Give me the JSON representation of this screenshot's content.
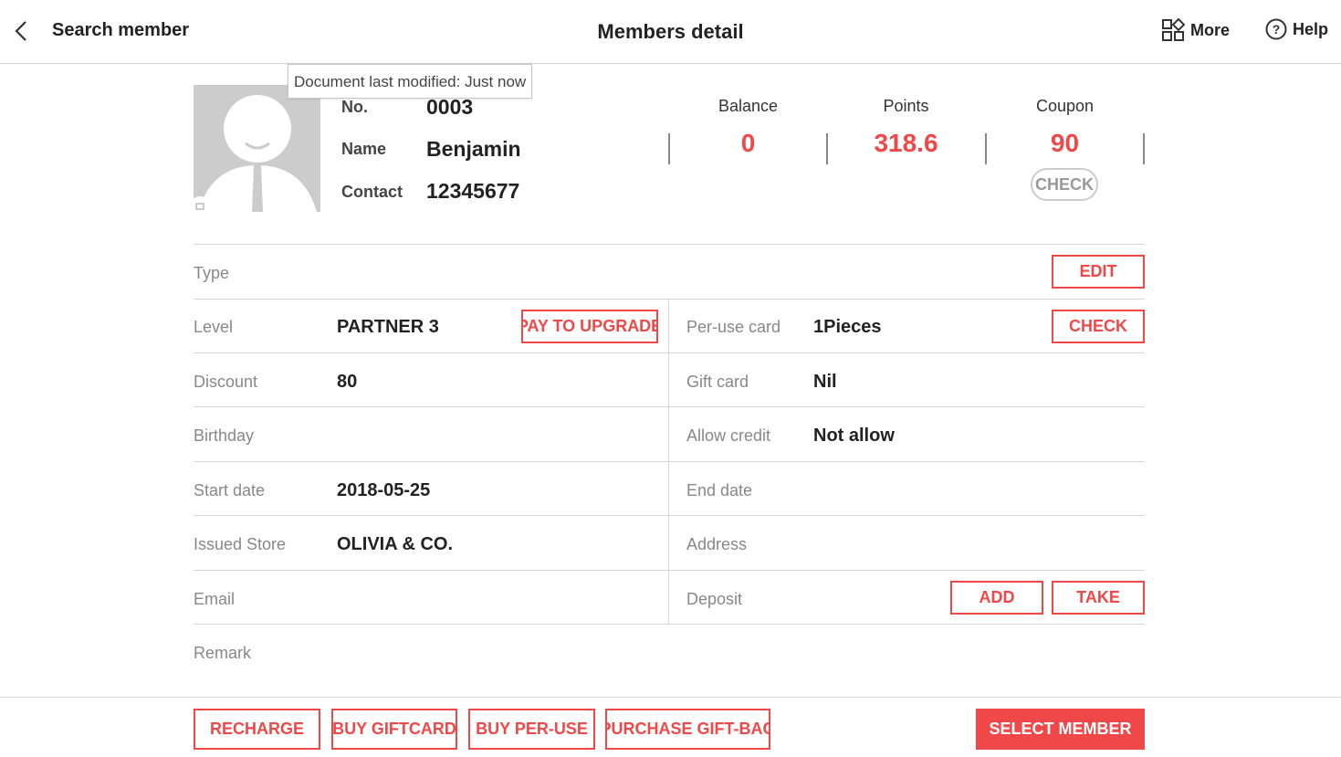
{
  "header": {
    "back_label": "Search member",
    "title": "Members detail",
    "more_label": "More",
    "help_label": "Help"
  },
  "tooltip": "Document last modified: Just now",
  "member": {
    "no_label": "No.",
    "no": "0003",
    "name_label": "Name",
    "name": "Benjamin",
    "contact_label": "Contact",
    "contact": "12345677"
  },
  "stats": {
    "balance_label": "Balance",
    "balance": "0",
    "points_label": "Points",
    "points": "318.6",
    "coupon_label": "Coupon",
    "coupon": "90",
    "check_label": "CHECK"
  },
  "details": {
    "type_label": "Type",
    "edit_label": "EDIT",
    "level_label": "Level",
    "level": "PARTNER 3",
    "upgrade_label": "PAY TO UPGRADE",
    "peruse_label": "Per-use card",
    "peruse": "1Pieces",
    "peruse_check_label": "CHECK",
    "discount_label": "Discount",
    "discount": "80",
    "giftcard_label": "Gift card",
    "giftcard": "Nil",
    "birthday_label": "Birthday",
    "credit_label": "Allow credit",
    "credit": "Not allow",
    "start_label": "Start date",
    "start": "2018-05-25",
    "end_label": "End date",
    "store_label": "Issued Store",
    "store": "OLIVIA & CO.",
    "address_label": "Address",
    "email_label": "Email",
    "deposit_label": "Deposit",
    "add_label": "ADD",
    "take_label": "TAKE",
    "remark_label": "Remark"
  },
  "footer": {
    "recharge": "RECHARGE",
    "giftcard": "BUY GIFTCARD",
    "peruse": "BUY PER-USE",
    "giftbag": "PURCHASE GIFT-BAG",
    "select": "SELECT MEMBER"
  },
  "colors": {
    "accent": "#f04848"
  }
}
